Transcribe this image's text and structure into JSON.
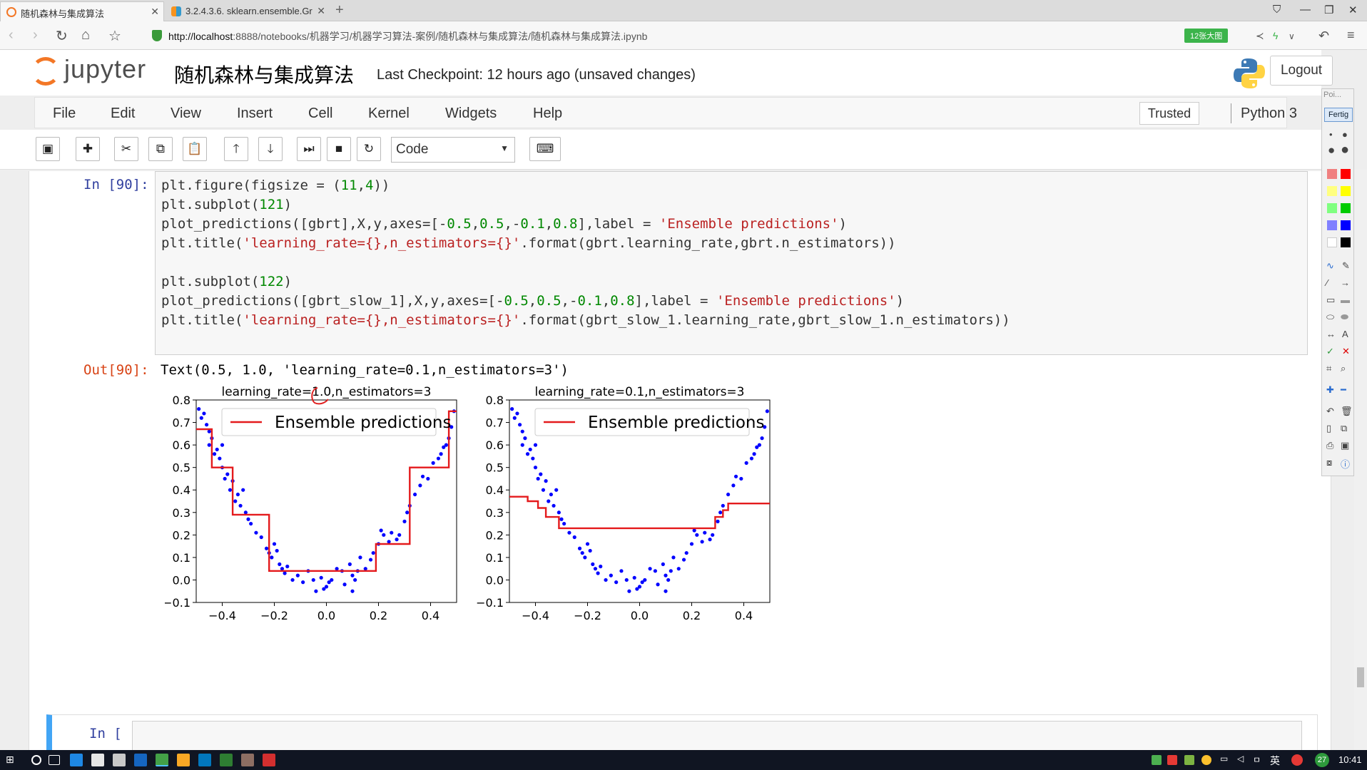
{
  "browser": {
    "tabs": [
      {
        "label": "随机森林与集成算法",
        "active": true
      },
      {
        "label": "3.2.4.3.6. sklearn.ensemble.Gr",
        "active": false
      }
    ],
    "new_tab": "+",
    "url_host": "http://localhost",
    "url_rest": ":8888/notebooks/机器学习/机器学习算法-案例/随机森林与集成算法/随机森林与集成算法.ipynb",
    "zoom_badge": "12张大图"
  },
  "jupyter": {
    "logo_text": "jupyter",
    "notebook_title": "随机森林与集成算法",
    "checkpoint": "Last Checkpoint: 12 hours ago (unsaved changes)",
    "logout": "Logout",
    "menus": [
      "File",
      "Edit",
      "View",
      "Insert",
      "Cell",
      "Kernel",
      "Widgets",
      "Help"
    ],
    "trusted": "Trusted",
    "kernel": "Python 3",
    "cell_type": "Code"
  },
  "cell": {
    "in_prompt": "In [90]:",
    "out_prompt": "Out[90]:",
    "output_text": "Text(0.5, 1.0, 'learning_rate=0.1,n_estimators=3')",
    "empty_prompt": "In [ ]:"
  },
  "palette": {
    "header": "Poi...",
    "done": "Fertig",
    "colors": [
      "#f08080",
      "#ff0000",
      "#ffff80",
      "#ffff00",
      "#80ff80",
      "#00cc00",
      "#8080ff",
      "#0000ff",
      "#ffffff",
      "#000000"
    ]
  },
  "taskbar": {
    "lang": "英",
    "badge": "27",
    "clock": "10:41"
  },
  "chart_data": [
    {
      "type": "line",
      "title": "learning_rate=1.0,n_estimators=3",
      "legend": [
        "Ensemble predictions"
      ],
      "legend_position": "top",
      "xlim": [
        -0.5,
        0.5
      ],
      "ylim": [
        -0.1,
        0.8
      ],
      "xticks": [
        "−0.4",
        "−0.2",
        "0.0",
        "0.2",
        "0.4"
      ],
      "yticks": [
        "−0.1",
        "0.0",
        "0.1",
        "0.2",
        "0.3",
        "0.4",
        "0.5",
        "0.6",
        "0.7",
        "0.8"
      ],
      "line_color": "#e41a1c",
      "point_color": "#0000ff",
      "prediction_step": [
        [
          -0.5,
          0.67
        ],
        [
          -0.44,
          0.67
        ],
        [
          -0.44,
          0.5
        ],
        [
          -0.36,
          0.5
        ],
        [
          -0.36,
          0.29
        ],
        [
          -0.22,
          0.29
        ],
        [
          -0.22,
          0.04
        ],
        [
          0.19,
          0.04
        ],
        [
          0.19,
          0.16
        ],
        [
          0.32,
          0.16
        ],
        [
          0.32,
          0.5
        ],
        [
          0.47,
          0.5
        ],
        [
          0.47,
          0.75
        ],
        [
          0.5,
          0.75
        ]
      ],
      "points": [
        [
          -0.49,
          0.76
        ],
        [
          -0.48,
          0.72
        ],
        [
          -0.47,
          0.74
        ],
        [
          -0.46,
          0.69
        ],
        [
          -0.45,
          0.66
        ],
        [
          -0.45,
          0.6
        ],
        [
          -0.44,
          0.63
        ],
        [
          -0.43,
          0.56
        ],
        [
          -0.42,
          0.58
        ],
        [
          -0.41,
          0.54
        ],
        [
          -0.4,
          0.6
        ],
        [
          -0.4,
          0.5
        ],
        [
          -0.39,
          0.45
        ],
        [
          -0.38,
          0.47
        ],
        [
          -0.37,
          0.4
        ],
        [
          -0.36,
          0.44
        ],
        [
          -0.35,
          0.35
        ],
        [
          -0.34,
          0.38
        ],
        [
          -0.33,
          0.33
        ],
        [
          -0.32,
          0.4
        ],
        [
          -0.31,
          0.3
        ],
        [
          -0.3,
          0.27
        ],
        [
          -0.29,
          0.25
        ],
        [
          -0.27,
          0.21
        ],
        [
          -0.25,
          0.19
        ],
        [
          -0.23,
          0.14
        ],
        [
          -0.22,
          0.12
        ],
        [
          -0.21,
          0.1
        ],
        [
          -0.2,
          0.16
        ],
        [
          -0.19,
          0.13
        ],
        [
          -0.18,
          0.07
        ],
        [
          -0.17,
          0.05
        ],
        [
          -0.16,
          0.03
        ],
        [
          -0.15,
          0.06
        ],
        [
          -0.13,
          0.0
        ],
        [
          -0.11,
          0.02
        ],
        [
          -0.09,
          -0.01
        ],
        [
          -0.07,
          0.04
        ],
        [
          -0.05,
          0.0
        ],
        [
          -0.04,
          -0.05
        ],
        [
          -0.02,
          0.01
        ],
        [
          -0.01,
          -0.04
        ],
        [
          0.0,
          -0.03
        ],
        [
          0.01,
          -0.01
        ],
        [
          0.02,
          0.0
        ],
        [
          0.04,
          0.05
        ],
        [
          0.06,
          0.04
        ],
        [
          0.07,
          -0.02
        ],
        [
          0.09,
          0.07
        ],
        [
          0.1,
          0.02
        ],
        [
          0.1,
          -0.05
        ],
        [
          0.11,
          0.0
        ],
        [
          0.12,
          0.04
        ],
        [
          0.13,
          0.1
        ],
        [
          0.15,
          0.05
        ],
        [
          0.17,
          0.09
        ],
        [
          0.18,
          0.12
        ],
        [
          0.2,
          0.16
        ],
        [
          0.21,
          0.22
        ],
        [
          0.22,
          0.2
        ],
        [
          0.24,
          0.17
        ],
        [
          0.25,
          0.21
        ],
        [
          0.27,
          0.18
        ],
        [
          0.28,
          0.2
        ],
        [
          0.3,
          0.26
        ],
        [
          0.31,
          0.3
        ],
        [
          0.32,
          0.33
        ],
        [
          0.34,
          0.38
        ],
        [
          0.36,
          0.42
        ],
        [
          0.37,
          0.46
        ],
        [
          0.39,
          0.45
        ],
        [
          0.41,
          0.52
        ],
        [
          0.43,
          0.54
        ],
        [
          0.44,
          0.56
        ],
        [
          0.45,
          0.59
        ],
        [
          0.46,
          0.6
        ],
        [
          0.47,
          0.63
        ],
        [
          0.48,
          0.68
        ],
        [
          0.49,
          0.75
        ]
      ]
    },
    {
      "type": "line",
      "title": "learning_rate=0.1,n_estimators=3",
      "legend": [
        "Ensemble predictions"
      ],
      "legend_position": "top",
      "xlim": [
        -0.5,
        0.5
      ],
      "ylim": [
        -0.1,
        0.8
      ],
      "xticks": [
        "−0.4",
        "−0.2",
        "0.0",
        "0.2",
        "0.4"
      ],
      "yticks": [
        "−0.1",
        "0.0",
        "0.1",
        "0.2",
        "0.3",
        "0.4",
        "0.5",
        "0.6",
        "0.7",
        "0.8"
      ],
      "line_color": "#e41a1c",
      "point_color": "#0000ff",
      "prediction_step": [
        [
          -0.5,
          0.37
        ],
        [
          -0.43,
          0.37
        ],
        [
          -0.43,
          0.35
        ],
        [
          -0.39,
          0.35
        ],
        [
          -0.39,
          0.32
        ],
        [
          -0.36,
          0.32
        ],
        [
          -0.36,
          0.28
        ],
        [
          -0.31,
          0.28
        ],
        [
          -0.31,
          0.23
        ],
        [
          0.29,
          0.23
        ],
        [
          0.29,
          0.28
        ],
        [
          0.32,
          0.28
        ],
        [
          0.32,
          0.31
        ],
        [
          0.34,
          0.31
        ],
        [
          0.34,
          0.34
        ],
        [
          0.5,
          0.34
        ]
      ],
      "points": [
        [
          -0.49,
          0.76
        ],
        [
          -0.48,
          0.72
        ],
        [
          -0.47,
          0.74
        ],
        [
          -0.46,
          0.69
        ],
        [
          -0.45,
          0.66
        ],
        [
          -0.45,
          0.6
        ],
        [
          -0.44,
          0.63
        ],
        [
          -0.43,
          0.56
        ],
        [
          -0.42,
          0.58
        ],
        [
          -0.41,
          0.54
        ],
        [
          -0.4,
          0.6
        ],
        [
          -0.4,
          0.5
        ],
        [
          -0.39,
          0.45
        ],
        [
          -0.38,
          0.47
        ],
        [
          -0.37,
          0.4
        ],
        [
          -0.36,
          0.44
        ],
        [
          -0.35,
          0.35
        ],
        [
          -0.34,
          0.38
        ],
        [
          -0.33,
          0.33
        ],
        [
          -0.32,
          0.4
        ],
        [
          -0.31,
          0.3
        ],
        [
          -0.3,
          0.27
        ],
        [
          -0.29,
          0.25
        ],
        [
          -0.27,
          0.21
        ],
        [
          -0.25,
          0.19
        ],
        [
          -0.23,
          0.14
        ],
        [
          -0.22,
          0.12
        ],
        [
          -0.21,
          0.1
        ],
        [
          -0.2,
          0.16
        ],
        [
          -0.19,
          0.13
        ],
        [
          -0.18,
          0.07
        ],
        [
          -0.17,
          0.05
        ],
        [
          -0.16,
          0.03
        ],
        [
          -0.15,
          0.06
        ],
        [
          -0.13,
          0.0
        ],
        [
          -0.11,
          0.02
        ],
        [
          -0.09,
          -0.01
        ],
        [
          -0.07,
          0.04
        ],
        [
          -0.05,
          0.0
        ],
        [
          -0.04,
          -0.05
        ],
        [
          -0.02,
          0.01
        ],
        [
          -0.01,
          -0.04
        ],
        [
          0.0,
          -0.03
        ],
        [
          0.01,
          -0.01
        ],
        [
          0.02,
          0.0
        ],
        [
          0.04,
          0.05
        ],
        [
          0.06,
          0.04
        ],
        [
          0.07,
          -0.02
        ],
        [
          0.09,
          0.07
        ],
        [
          0.1,
          0.02
        ],
        [
          0.1,
          -0.05
        ],
        [
          0.11,
          0.0
        ],
        [
          0.12,
          0.04
        ],
        [
          0.13,
          0.1
        ],
        [
          0.15,
          0.05
        ],
        [
          0.17,
          0.09
        ],
        [
          0.18,
          0.12
        ],
        [
          0.2,
          0.16
        ],
        [
          0.21,
          0.22
        ],
        [
          0.22,
          0.2
        ],
        [
          0.24,
          0.17
        ],
        [
          0.25,
          0.21
        ],
        [
          0.27,
          0.18
        ],
        [
          0.28,
          0.2
        ],
        [
          0.3,
          0.26
        ],
        [
          0.31,
          0.3
        ],
        [
          0.32,
          0.33
        ],
        [
          0.34,
          0.38
        ],
        [
          0.36,
          0.42
        ],
        [
          0.37,
          0.46
        ],
        [
          0.39,
          0.45
        ],
        [
          0.41,
          0.52
        ],
        [
          0.43,
          0.54
        ],
        [
          0.44,
          0.56
        ],
        [
          0.45,
          0.59
        ],
        [
          0.46,
          0.6
        ],
        [
          0.47,
          0.63
        ],
        [
          0.48,
          0.68
        ],
        [
          0.49,
          0.75
        ]
      ]
    }
  ]
}
